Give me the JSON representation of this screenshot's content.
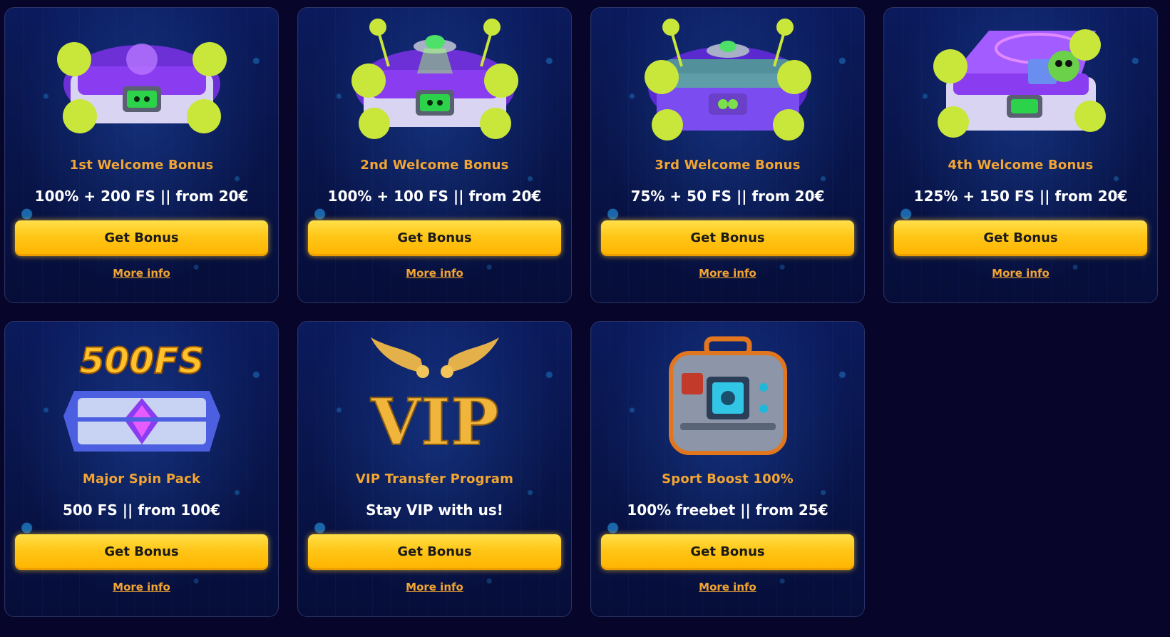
{
  "cards": [
    {
      "title": "1st Welcome Bonus",
      "offer": "100% + 200 FS || from 20€",
      "button": "Get Bonus",
      "more": "More info",
      "icon": "alien-chest-icon"
    },
    {
      "title": "2nd Welcome Bonus",
      "offer": "100% + 100 FS || from 20€",
      "button": "Get Bonus",
      "more": "More info",
      "icon": "ufo-chest-icon"
    },
    {
      "title": "3rd Welcome Bonus",
      "offer": "75% + 50 FS || from 20€",
      "button": "Get Bonus",
      "more": "More info",
      "icon": "ufo-chest-icon"
    },
    {
      "title": "4th Welcome Bonus",
      "offer": "125% + 150 FS || from 20€",
      "button": "Get Bonus",
      "more": "More info",
      "icon": "open-alien-chest-icon"
    },
    {
      "title": "Major Spin Pack",
      "offer": "500 FS || from 100€",
      "button": "Get Bonus",
      "more": "More info",
      "icon": "500fs-chest-icon",
      "art_text": "500FS"
    },
    {
      "title": "VIP Transfer Program",
      "offer": "Stay VIP with us!",
      "button": "Get Bonus",
      "more": "More info",
      "icon": "vip-wings-icon",
      "art_text": "VIP"
    },
    {
      "title": "Sport Boost 100%",
      "offer": "100% freebet || from 25€",
      "button": "Get Bonus",
      "more": "More info",
      "icon": "sport-case-icon"
    }
  ],
  "colors": {
    "background": "#07062a",
    "title": "#f2a532",
    "button": "#ffc617",
    "link": "#f2a532"
  }
}
